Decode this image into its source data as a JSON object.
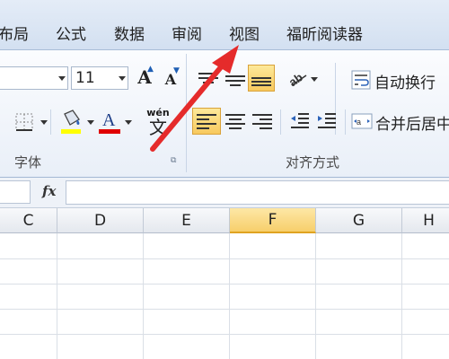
{
  "tabs": [
    {
      "label": "布局"
    },
    {
      "label": "公式"
    },
    {
      "label": "数据"
    },
    {
      "label": "审阅"
    },
    {
      "label": "视图"
    },
    {
      "label": "福昕阅读器"
    }
  ],
  "font_group": {
    "font_size": "11",
    "grow_label": "A",
    "shrink_label": "A",
    "font_color_label": "A",
    "phonetic_top": "wén",
    "phonetic_bottom": "文",
    "label": "字体"
  },
  "align_group": {
    "wrap_text_label": "自动换行",
    "merge_center_label": "合并后居中",
    "label": "对齐方式"
  },
  "formula_bar": {
    "fx_label": "fx",
    "value": ""
  },
  "columns": [
    "C",
    "D",
    "E",
    "F",
    "G",
    "H"
  ],
  "selected_column": "F",
  "colors": {
    "highlight_yellow": "#ffff00",
    "font_red": "#e00000",
    "arrow_red": "#e52b2b",
    "selected_header": "#f7cf6b"
  }
}
